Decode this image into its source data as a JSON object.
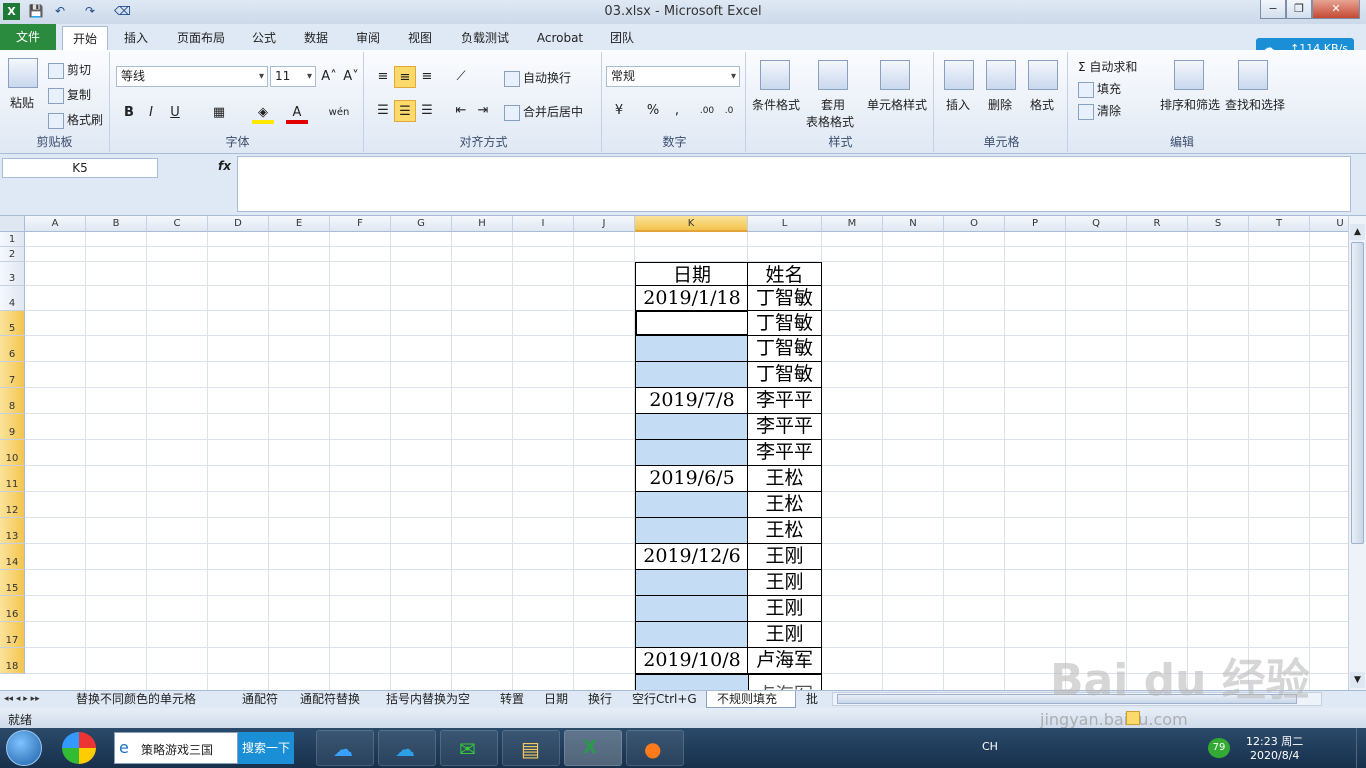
{
  "window": {
    "title": "03.xlsx  -  Microsoft Excel",
    "file_badge": "X",
    "min": "−",
    "max": "❐",
    "close": "✕"
  },
  "quick_access": [
    "💾",
    "↶",
    "↷",
    "⌫"
  ],
  "ribbon_tabs": [
    "文件",
    "开始",
    "插入",
    "页面布局",
    "公式",
    "数据",
    "审阅",
    "视图",
    "负载测试",
    "Acrobat",
    "团队"
  ],
  "net_speed": "↑114 KB/s",
  "clipboard": {
    "paste": "粘贴",
    "cut": "剪切",
    "copy": "复制",
    "format_painter": "格式刷",
    "label": "剪贴板"
  },
  "font": {
    "name": "等线",
    "size": "11",
    "grow": "A˄",
    "shrink": "A˅",
    "bold": "B",
    "italic": "I",
    "underline": "U",
    "label": "字体"
  },
  "alignment": {
    "wrap": "自动换行",
    "merge": "合并后居中",
    "label": "对齐方式"
  },
  "number": {
    "format": "常规",
    "percent": "%",
    "comma": ",",
    "label": "数字"
  },
  "styles": {
    "conditional": "条件格式",
    "table_line1": "套用",
    "table_line2": "表格格式",
    "cell_styles": "单元格样式",
    "label": "样式"
  },
  "cells": {
    "insert": "插入",
    "delete": "删除",
    "format": "格式",
    "label": "单元格"
  },
  "editing": {
    "autosum": "Σ 自动求和",
    "fill": "填充",
    "clear": "清除",
    "sort": "排序和筛选",
    "find": "查找和选择",
    "label": "编辑"
  },
  "formula_bar": {
    "name_box": "K5",
    "fx": "fx",
    "content": ""
  },
  "columns": [
    "A",
    "B",
    "C",
    "D",
    "E",
    "F",
    "G",
    "H",
    "I",
    "J",
    "K",
    "L",
    "M",
    "N",
    "O",
    "P",
    "Q",
    "R",
    "S",
    "T",
    "U"
  ],
  "rows": [
    "1",
    "2",
    "3",
    "4",
    "5",
    "6",
    "7",
    "8",
    "9",
    "10",
    "11",
    "12",
    "13",
    "14",
    "15",
    "16",
    "17",
    "18"
  ],
  "table": {
    "header": [
      "日期",
      "姓名"
    ],
    "dates": [
      "2019/1/18",
      "",
      "",
      "",
      "2019/7/8",
      "",
      "",
      "2019/6/5",
      "",
      "",
      "2019/12/6",
      "",
      "",
      "",
      "2019/10/8"
    ],
    "names": [
      "丁智敏",
      "丁智敏",
      "丁智敏",
      "丁智敏",
      "李平平",
      "李平平",
      "李平平",
      "王松",
      "王松",
      "王松",
      "王刚",
      "王刚",
      "王刚",
      "王刚",
      "卢海军"
    ],
    "partial_name": "卢海军"
  },
  "sheet_tabs": [
    "替换不同颜色的单元格",
    "通配符",
    "通配符替换",
    "括号内替换为空",
    "转置",
    "日期",
    "换行",
    "空行Ctrl+G",
    "不规则填充",
    "批"
  ],
  "sheet_nav": "◂◂ ◂ ▸ ▸▸",
  "status": {
    "ready": "就绪"
  },
  "watermark": {
    "brand": "Bai du 经验",
    "url": "jingyan.baidu.com"
  },
  "taskbar": {
    "search_text": "策略游戏三国",
    "search_button": "搜索一下",
    "lang": "CH",
    "battery": "79",
    "time": "12:23 周二",
    "date": "2020/8/4"
  }
}
